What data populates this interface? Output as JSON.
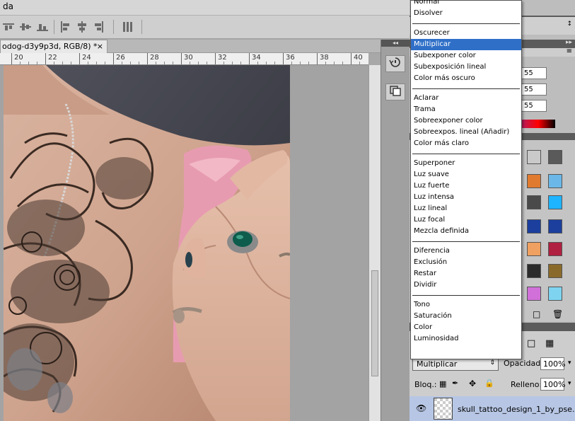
{
  "menubar": {
    "title_fragment": "da",
    "window_buttons": [
      "–",
      "□",
      "✕"
    ]
  },
  "options_bar": {
    "collapse_arrow": "↕"
  },
  "document_tab": {
    "title": "odog-d3y9p3d, RGB/8) *",
    "close": "×"
  },
  "ruler": {
    "labels": [
      "20",
      "22",
      "24",
      "26",
      "28",
      "30",
      "32",
      "34",
      "36",
      "38",
      "40"
    ]
  },
  "dock": {
    "header": "◂◂",
    "buttons": [
      "history-icon",
      "layer-comps-icon"
    ]
  },
  "panels": {
    "header_arrows": [
      "▸▸",
      "≡"
    ],
    "color_values": [
      "55",
      "55",
      "55"
    ],
    "swatch_colors": [
      [
        "#c9c9c9",
        "#5a5a5a"
      ],
      [
        "#e07a2f",
        "#6bb8e8"
      ],
      [
        "#4a4a4a",
        "#1fb4ff"
      ],
      [
        "#1c3f9e",
        "#1c3f9e"
      ],
      [
        "#f0a060",
        "#b02040"
      ],
      [
        "#2b2b2b",
        "#8a6a2a"
      ],
      [
        "#d070d8",
        "#7ed4f0"
      ]
    ]
  },
  "layers": {
    "blend_mode": "Multiplicar",
    "opacity_label": "Opacidad:",
    "opacity_value": "100%",
    "lock_label": "Bloq.:",
    "fill_label": "Relleno:",
    "fill_value": "100%",
    "layer_name": "skull_tattoo_design_1_by_pse..."
  },
  "blend_menu": {
    "selected": "Multiplicar",
    "groups": [
      [
        "Normal",
        "Disolver"
      ],
      [
        "Oscurecer",
        "Multiplicar",
        "Subexponer color",
        "Subexposición lineal",
        "Color más oscuro"
      ],
      [
        "Aclarar",
        "Trama",
        "Sobreexponer color",
        "Sobreexpos. lineal (Añadir)",
        "Color más claro"
      ],
      [
        "Superponer",
        "Luz suave",
        "Luz fuerte",
        "Luz intensa",
        "Luz lineal",
        "Luz focal",
        "Mezcla definida"
      ],
      [
        "Diferencia",
        "Exclusión",
        "Restar",
        "Dividir"
      ],
      [
        "Tono",
        "Saturación",
        "Color",
        "Luminosidad"
      ]
    ]
  }
}
